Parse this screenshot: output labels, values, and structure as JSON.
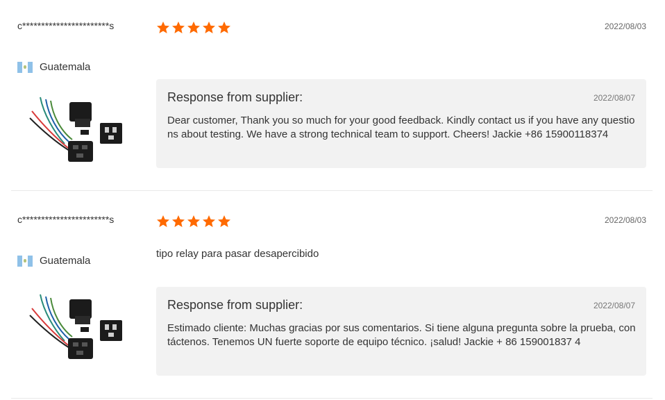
{
  "reviews": [
    {
      "username": "c***********************s",
      "country": "Guatemala",
      "rating": 5,
      "date": "2022/08/03",
      "text": "",
      "response": {
        "title": "Response from supplier:",
        "date": "2022/08/07",
        "text": "Dear customer, Thank you so much for your good feedback. Kindly contact us if you have any questions about testing. We have a strong technical team to support. Cheers! Jackie +86 15900118374"
      }
    },
    {
      "username": "c***********************s",
      "country": "Guatemala",
      "rating": 5,
      "date": "2022/08/03",
      "text": "tipo relay para pasar desapercibido",
      "response": {
        "title": "Response from supplier:",
        "date": "2022/08/07",
        "text": "Estimado cliente: Muchas gracias por sus comentarios. Si tiene alguna pregunta sobre la prueba, contáctenos. Tenemos UN fuerte soporte de equipo técnico. ¡salud! Jackie + 86 159001837 4"
      }
    }
  ],
  "colors": {
    "star": "#ff6a00",
    "response_bg": "#f2f2f2",
    "divider": "#e8e8e8"
  },
  "icons": {
    "star": "star-icon",
    "flag": "guatemala-flag-icon"
  }
}
